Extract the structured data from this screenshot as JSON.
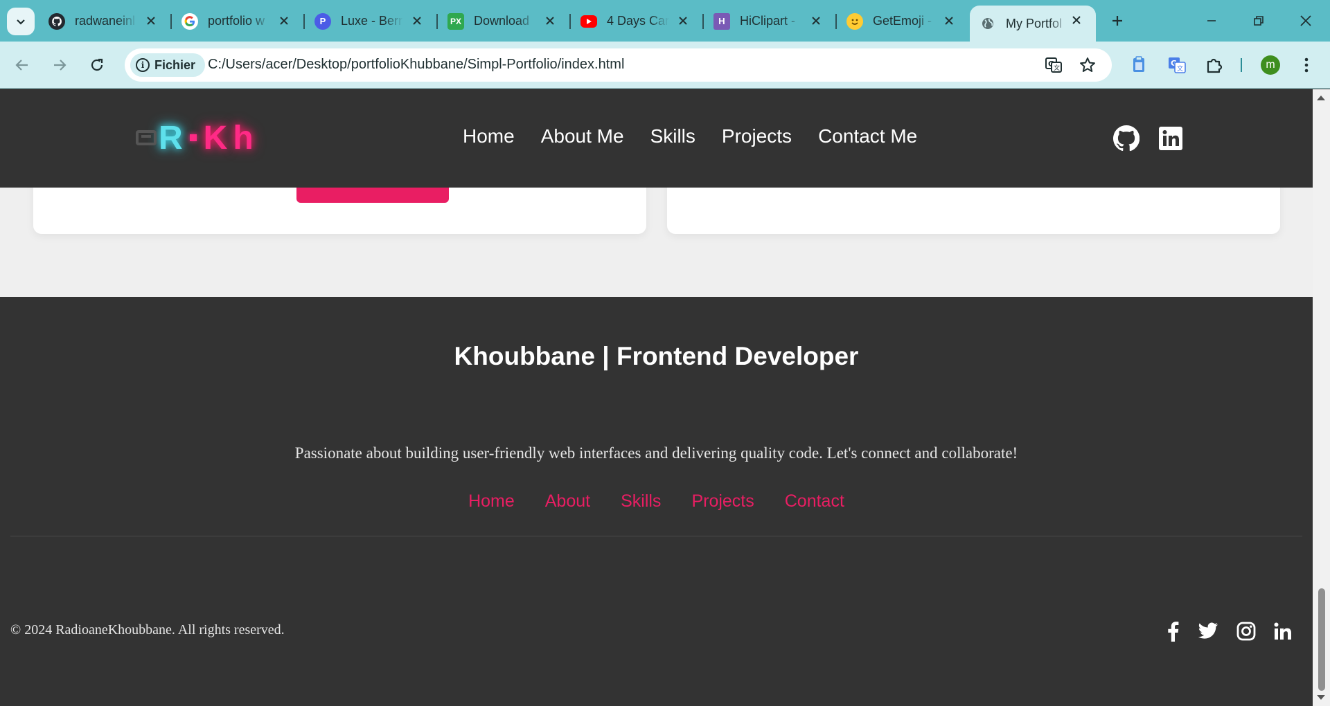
{
  "browser": {
    "tabs": [
      {
        "title": "radwaneinl",
        "favicon": "github-icon"
      },
      {
        "title": "portfolio w",
        "favicon": "google-icon"
      },
      {
        "title": "Luxe - Berr",
        "favicon": "p-logo-icon"
      },
      {
        "title": "Download",
        "favicon": "px-logo-icon"
      },
      {
        "title": "4 Days Car",
        "favicon": "youtube-icon"
      },
      {
        "title": "HiClipart -",
        "favicon": "hiclipart-icon"
      },
      {
        "title": "GetEmoji -",
        "favicon": "emoji-icon"
      },
      {
        "title": "My Portfol",
        "favicon": "globe-icon",
        "active": true
      }
    ],
    "security_chip": "Fichier",
    "url": "C:/Users/acer/Desktop/portfolioKhubbane/Simpl-Portfolio/index.html",
    "profile_initial": "m",
    "colors": {
      "tabbar": "#5bbcc6",
      "toolbar": "#d2eef1",
      "profile": "#3e8e1e"
    }
  },
  "site": {
    "logo": {
      "r": "R",
      "kh": "Kh"
    },
    "nav": [
      "Home",
      "About Me",
      "Skills",
      "Projects",
      "Contact Me"
    ],
    "header_social": [
      "github-icon",
      "linkedin-icon"
    ],
    "accent": "#e91e63",
    "footer": {
      "title": "Khoubbane | Frontend Developer",
      "description": "Passionate about building user-friendly web interfaces and delivering quality code. Let's connect and collaborate!",
      "links": [
        "Home",
        "About",
        "Skills",
        "Projects",
        "Contact"
      ],
      "copyright": "© 2024 RadioaneKhoubbane. All rights reserved.",
      "social": [
        "facebook-icon",
        "twitter-icon",
        "instagram-icon",
        "linkedin-icon"
      ]
    }
  }
}
